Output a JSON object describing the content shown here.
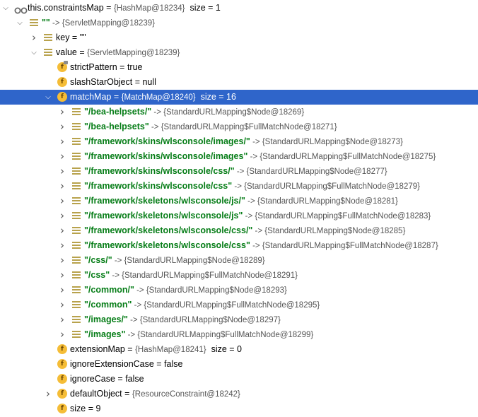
{
  "rows": [
    {
      "indent": 0,
      "expand": "down",
      "icon": "oo",
      "key": "this.constraintsMap",
      "sep": " = ",
      "ref": "{HashMap@18234}",
      "extra": "  size = 1",
      "str": false
    },
    {
      "indent": 1,
      "expand": "down",
      "icon": "list",
      "key": "\"\"",
      "sep": " -> ",
      "ref": "{ServletMapping@18239}",
      "extra": "",
      "str": true
    },
    {
      "indent": 2,
      "expand": "right",
      "icon": "list",
      "key": "key",
      "sep": " = ",
      "ref": "\"\"",
      "extra": "",
      "str": false
    },
    {
      "indent": 2,
      "expand": "down",
      "icon": "list",
      "key": "value",
      "sep": " = ",
      "ref": "{ServletMapping@18239}",
      "extra": "",
      "str": false
    },
    {
      "indent": 3,
      "expand": "",
      "icon": "f-lock",
      "key": "strictPattern",
      "sep": " = ",
      "ref": "",
      "extra": "true",
      "str": false
    },
    {
      "indent": 3,
      "expand": "",
      "icon": "f",
      "key": "slashStarObject",
      "sep": " = ",
      "ref": "",
      "extra": "null",
      "str": false
    },
    {
      "indent": 3,
      "expand": "down",
      "icon": "f",
      "key": "matchMap",
      "sep": " = ",
      "ref": "{MatchMap@18240}",
      "extra": "  size = 16",
      "str": false,
      "selected": true
    },
    {
      "indent": 4,
      "expand": "right",
      "icon": "list",
      "key": "\"/bea-helpsets/\"",
      "sep": " -> ",
      "ref": "{StandardURLMapping$Node@18269}",
      "extra": "",
      "str": true
    },
    {
      "indent": 4,
      "expand": "right",
      "icon": "list",
      "key": "\"/bea-helpsets\"",
      "sep": " -> ",
      "ref": "{StandardURLMapping$FullMatchNode@18271}",
      "extra": "",
      "str": true
    },
    {
      "indent": 4,
      "expand": "right",
      "icon": "list",
      "key": "\"/framework/skins/wlsconsole/images/\"",
      "sep": " -> ",
      "ref": "{StandardURLMapping$Node@18273}",
      "extra": "",
      "str": true
    },
    {
      "indent": 4,
      "expand": "right",
      "icon": "list",
      "key": "\"/framework/skins/wlsconsole/images\"",
      "sep": " -> ",
      "ref": "{StandardURLMapping$FullMatchNode@18275}",
      "extra": "",
      "str": true
    },
    {
      "indent": 4,
      "expand": "right",
      "icon": "list",
      "key": "\"/framework/skins/wlsconsole/css/\"",
      "sep": " -> ",
      "ref": "{StandardURLMapping$Node@18277}",
      "extra": "",
      "str": true
    },
    {
      "indent": 4,
      "expand": "right",
      "icon": "list",
      "key": "\"/framework/skins/wlsconsole/css\"",
      "sep": " -> ",
      "ref": "{StandardURLMapping$FullMatchNode@18279}",
      "extra": "",
      "str": true
    },
    {
      "indent": 4,
      "expand": "right",
      "icon": "list",
      "key": "\"/framework/skeletons/wlsconsole/js/\"",
      "sep": " -> ",
      "ref": "{StandardURLMapping$Node@18281}",
      "extra": "",
      "str": true
    },
    {
      "indent": 4,
      "expand": "right",
      "icon": "list",
      "key": "\"/framework/skeletons/wlsconsole/js\"",
      "sep": " -> ",
      "ref": "{StandardURLMapping$FullMatchNode@18283}",
      "extra": "",
      "str": true
    },
    {
      "indent": 4,
      "expand": "right",
      "icon": "list",
      "key": "\"/framework/skeletons/wlsconsole/css/\"",
      "sep": " -> ",
      "ref": "{StandardURLMapping$Node@18285}",
      "extra": "",
      "str": true
    },
    {
      "indent": 4,
      "expand": "right",
      "icon": "list",
      "key": "\"/framework/skeletons/wlsconsole/css\"",
      "sep": " -> ",
      "ref": "{StandardURLMapping$FullMatchNode@18287}",
      "extra": "",
      "str": true
    },
    {
      "indent": 4,
      "expand": "right",
      "icon": "list",
      "key": "\"/css/\"",
      "sep": " -> ",
      "ref": "{StandardURLMapping$Node@18289}",
      "extra": "",
      "str": true
    },
    {
      "indent": 4,
      "expand": "right",
      "icon": "list",
      "key": "\"/css\"",
      "sep": " -> ",
      "ref": "{StandardURLMapping$FullMatchNode@18291}",
      "extra": "",
      "str": true
    },
    {
      "indent": 4,
      "expand": "right",
      "icon": "list",
      "key": "\"/common/\"",
      "sep": " -> ",
      "ref": "{StandardURLMapping$Node@18293}",
      "extra": "",
      "str": true
    },
    {
      "indent": 4,
      "expand": "right",
      "icon": "list",
      "key": "\"/common\"",
      "sep": " -> ",
      "ref": "{StandardURLMapping$FullMatchNode@18295}",
      "extra": "",
      "str": true
    },
    {
      "indent": 4,
      "expand": "right",
      "icon": "list",
      "key": "\"/images/\"",
      "sep": " -> ",
      "ref": "{StandardURLMapping$Node@18297}",
      "extra": "",
      "str": true
    },
    {
      "indent": 4,
      "expand": "right",
      "icon": "list",
      "key": "\"/images\"",
      "sep": " -> ",
      "ref": "{StandardURLMapping$FullMatchNode@18299}",
      "extra": "",
      "str": true
    },
    {
      "indent": 3,
      "expand": "",
      "icon": "f",
      "key": "extensionMap",
      "sep": " = ",
      "ref": "{HashMap@18241}",
      "extra": "  size = 0",
      "str": false
    },
    {
      "indent": 3,
      "expand": "",
      "icon": "f",
      "key": "ignoreExtensionCase",
      "sep": " = ",
      "ref": "",
      "extra": "false",
      "str": false
    },
    {
      "indent": 3,
      "expand": "",
      "icon": "f",
      "key": "ignoreCase",
      "sep": " = ",
      "ref": "",
      "extra": "false",
      "str": false
    },
    {
      "indent": 3,
      "expand": "right",
      "icon": "f",
      "key": "defaultObject",
      "sep": " = ",
      "ref": "{ResourceConstraint@18242}",
      "extra": "",
      "str": false
    },
    {
      "indent": 3,
      "expand": "",
      "icon": "f",
      "key": "size",
      "sep": " = ",
      "ref": "",
      "extra": "9",
      "str": false
    }
  ],
  "colors": {
    "selection": "#2f65ca",
    "string": "#067d17",
    "field_icon": "#f5bd37",
    "list_icon": "#b8a24c"
  },
  "icons": {
    "f": "field-icon",
    "f-lock": "final-field-icon",
    "list": "list-entry-icon",
    "oo": "watch-icon"
  }
}
